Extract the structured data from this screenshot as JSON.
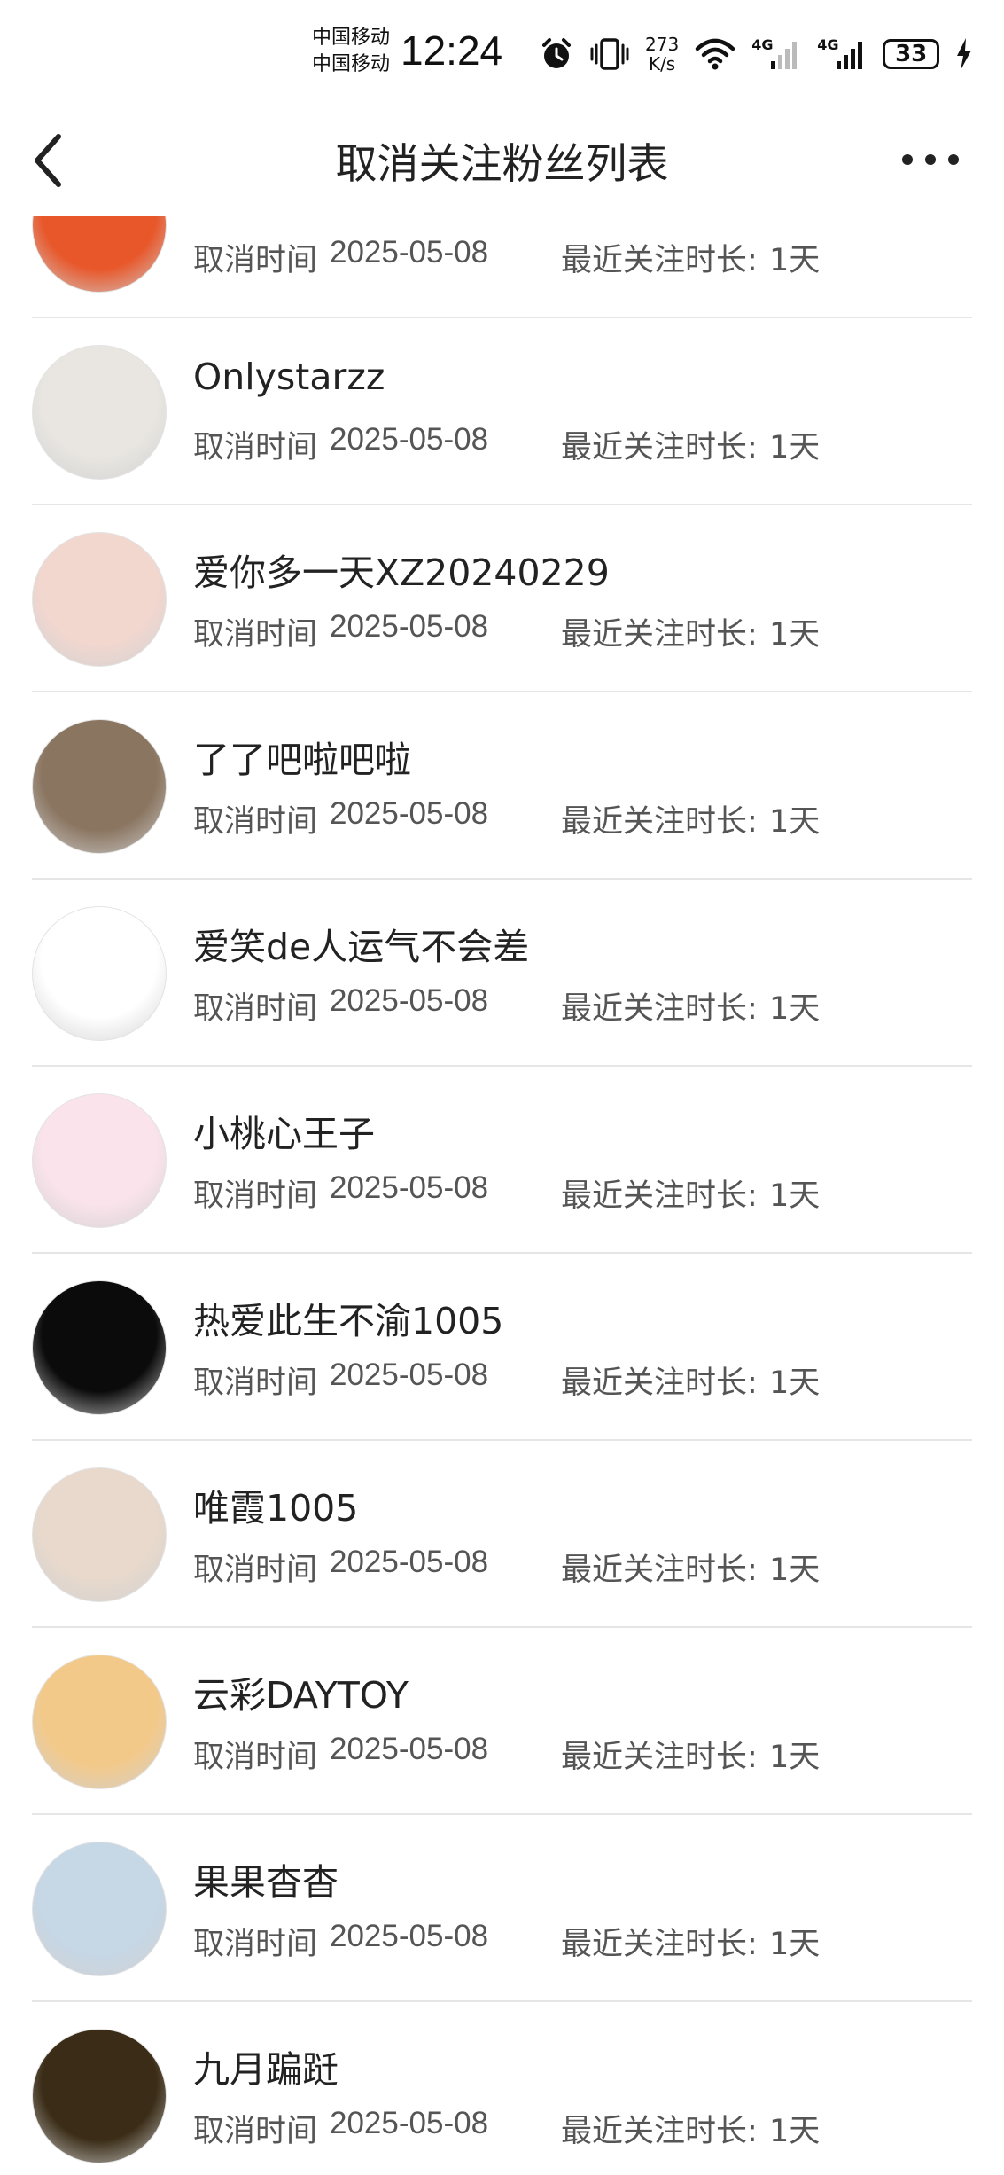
{
  "status_bar": {
    "carrier_1": "中国移动",
    "carrier_2": "中国移动",
    "time": "12:24",
    "net_speed_value": "273",
    "net_speed_unit": "K/s",
    "signal_1_label": "4G",
    "signal_2_label": "4G",
    "battery": "33",
    "icons": [
      "alarm-icon",
      "vibrate-icon",
      "wifi-icon",
      "signal-icon",
      "signal-icon",
      "battery-icon",
      "charging-icon"
    ]
  },
  "nav": {
    "title": "取消关注粉丝列表",
    "icons": [
      "back-arrow-icon",
      "more-icon"
    ]
  },
  "list": {
    "time_label": "取消时间",
    "duration_label": "最近关注时长:",
    "items": [
      {
        "name": "",
        "time": "2025-05-08",
        "duration": "1天",
        "avatar_color": "#e8572a"
      },
      {
        "name": "Onlystarzz",
        "time": "2025-05-08",
        "duration": "1天",
        "avatar_color": "#e9e6e1"
      },
      {
        "name": "爱你多一天XZ20240229",
        "time": "2025-05-08",
        "duration": "1天",
        "avatar_color": "#f2d7cf"
      },
      {
        "name": "了了吧啦吧啦",
        "time": "2025-05-08",
        "duration": "1天",
        "avatar_color": "#8a7560"
      },
      {
        "name": "爱笑de人运气不会差",
        "time": "2025-05-08",
        "duration": "1天",
        "avatar_color": "#ffffff"
      },
      {
        "name": "小桃心王子",
        "time": "2025-05-08",
        "duration": "1天",
        "avatar_color": "#fbe3ec"
      },
      {
        "name": "热爱此生不渝1005",
        "time": "2025-05-08",
        "duration": "1天",
        "avatar_color": "#0b0b0b"
      },
      {
        "name": "唯霞1005",
        "time": "2025-05-08",
        "duration": "1天",
        "avatar_color": "#e8d9cc"
      },
      {
        "name": "云彩DAYTOY",
        "time": "2025-05-08",
        "duration": "1天",
        "avatar_color": "#f3c98a"
      },
      {
        "name": "果果杳杳",
        "time": "2025-05-08",
        "duration": "1天",
        "avatar_color": "#c6d7e6"
      },
      {
        "name": "九月蹁跹",
        "time": "2025-05-08",
        "duration": "1天",
        "avatar_color": "#3a2c16"
      }
    ]
  }
}
